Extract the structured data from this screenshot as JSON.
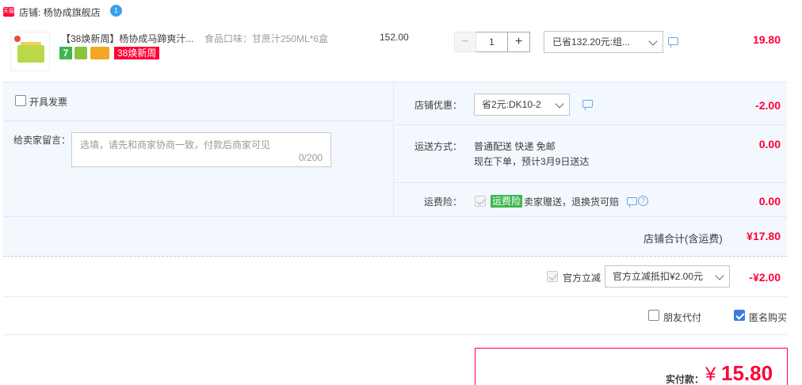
{
  "shop": {
    "tmall_badge": "天猫",
    "label": "店铺:",
    "name": "杨协成旗舰店",
    "chat_icon_text": "1"
  },
  "item": {
    "title": "【38焕新周】杨协成马蹄爽汁...",
    "tag_7": "7",
    "tag_event": "38焕新周",
    "sku_label": "食品口味：",
    "sku_value": "甘蔗汁250ML*6盒",
    "unit_price": "152.00",
    "quantity": "1",
    "qty_minus": "−",
    "qty_plus": "+",
    "promo_selected": "已省132.20元:组...",
    "total": "19.80"
  },
  "order_options": {
    "invoice_label": "开具发票",
    "memo_label": "给卖家留言：",
    "memo_placeholder": "选填，请先和商家协商一致，付款后商家可见",
    "memo_count": "0/200",
    "shop_discount_label": "店铺优惠：",
    "shop_discount_selected": "省2元:DK10-2",
    "shop_discount_value": "-2.00",
    "shipping_label": "运送方式：",
    "shipping_method": "普通配送 快递 免邮",
    "shipping_eta": "现在下单，预计3月9日送达",
    "shipping_value": "0.00",
    "insurance_label": "运费险：",
    "insurance_tag": "运费险",
    "insurance_text": "卖家赠送，退换货可赔",
    "insurance_value": "0.00",
    "shop_total_label": "店铺合计(含运费)",
    "shop_total_value": "¥17.80"
  },
  "official": {
    "label": "官方立减",
    "selected": "官方立减抵扣¥2.00元",
    "value": "-¥2.00"
  },
  "buyer_options": {
    "friend_pay": "朋友代付",
    "anonymous": "匿名购买"
  },
  "payment": {
    "label": "实付款：",
    "currency": "¥",
    "amount": "15.80"
  },
  "colors": {
    "accent_red": "#ff0036",
    "panel_bg": "#f3f7fe",
    "link_blue": "#3d7de0"
  }
}
